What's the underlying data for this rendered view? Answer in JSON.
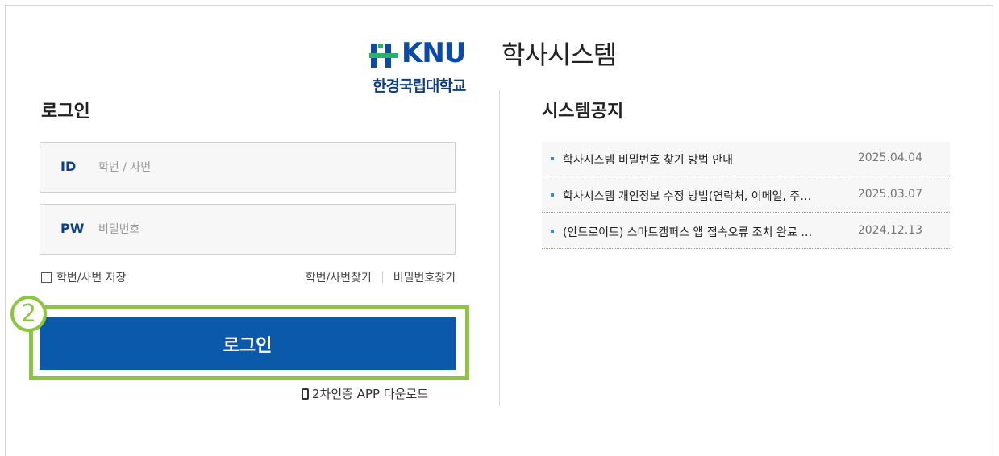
{
  "logo": {
    "brand": "KNU",
    "title": "학사시스템",
    "subtitle": "한경국립대학교"
  },
  "login": {
    "heading": "로그인",
    "id_label": "ID",
    "id_placeholder": "학번 / 사번",
    "pw_label": "PW",
    "pw_placeholder": "비밀번호",
    "save_label": "학번/사번 저장",
    "find_id": "학번/사번찾기",
    "find_pw": "비밀번호찾기",
    "button": "로그인",
    "app_download": "2차인증 APP 다운로드"
  },
  "annotation": {
    "step": "2"
  },
  "notice": {
    "heading": "시스템공지",
    "items": [
      {
        "title": "학사시스템 비밀번호 찾기 방법 안내",
        "date": "2025.04.04"
      },
      {
        "title": "학사시스템 개인정보 수정 방법(연락처, 이메일, 주…",
        "date": "2025.03.07"
      },
      {
        "title": "(안드로이드) 스마트캠퍼스 앱 접속오류 조치 완료 …",
        "date": "2024.12.13"
      }
    ]
  },
  "colors": {
    "primary": "#0b59ab",
    "highlight": "#8cc63f",
    "brand": "#0b4aa8"
  }
}
